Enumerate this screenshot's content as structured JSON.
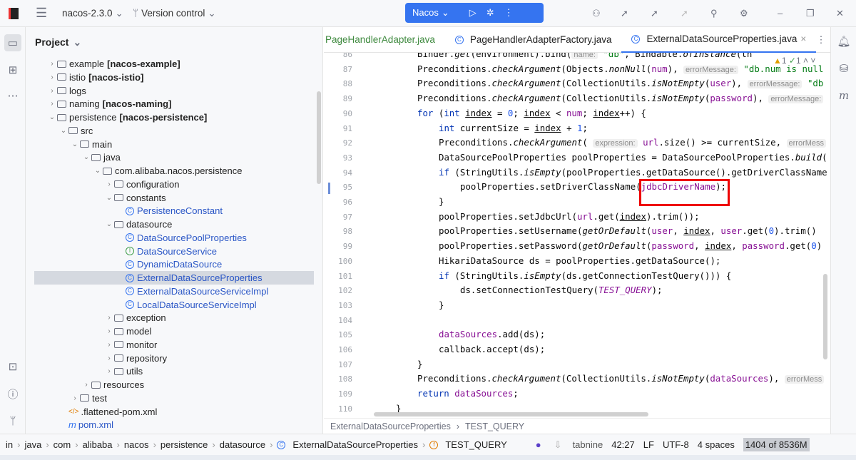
{
  "titlebar": {
    "project": "nacos-2.3.0",
    "vcs": "Version control",
    "run_config": "Nacos"
  },
  "project_panel": {
    "title": "Project",
    "tree": [
      {
        "label": "example",
        "module": "[nacos-example]",
        "level": 1,
        "type": "folder",
        "arrow": "›"
      },
      {
        "label": "istio",
        "module": "[nacos-istio]",
        "level": 1,
        "type": "folder",
        "arrow": "›"
      },
      {
        "label": "logs",
        "module": "",
        "level": 1,
        "type": "folder",
        "arrow": "›"
      },
      {
        "label": "naming",
        "module": "[nacos-naming]",
        "level": 1,
        "type": "folder",
        "arrow": "›"
      },
      {
        "label": "persistence",
        "module": "[nacos-persistence]",
        "level": 1,
        "type": "folder",
        "arrow": "⌄"
      },
      {
        "label": "src",
        "module": "",
        "level": 2,
        "type": "folder",
        "arrow": "⌄"
      },
      {
        "label": "main",
        "module": "",
        "level": 3,
        "type": "folder",
        "arrow": "⌄"
      },
      {
        "label": "java",
        "module": "",
        "level": 4,
        "type": "folder",
        "arrow": "⌄"
      },
      {
        "label": "com.alibaba.nacos.persistence",
        "module": "",
        "level": 5,
        "type": "folder",
        "arrow": "⌄"
      },
      {
        "label": "configuration",
        "module": "",
        "level": 6,
        "type": "folder",
        "arrow": "›"
      },
      {
        "label": "constants",
        "module": "",
        "level": 6,
        "type": "folder",
        "arrow": "⌄"
      },
      {
        "label": "PersistenceConstant",
        "module": "",
        "level": 7,
        "type": "class",
        "arrow": ""
      },
      {
        "label": "datasource",
        "module": "",
        "level": 6,
        "type": "folder",
        "arrow": "⌄"
      },
      {
        "label": "DataSourcePoolProperties",
        "module": "",
        "level": 7,
        "type": "class",
        "arrow": ""
      },
      {
        "label": "DataSourceService",
        "module": "",
        "level": 7,
        "type": "iface",
        "arrow": ""
      },
      {
        "label": "DynamicDataSource",
        "module": "",
        "level": 7,
        "type": "class",
        "arrow": ""
      },
      {
        "label": "ExternalDataSourceProperties",
        "module": "",
        "level": 7,
        "type": "class",
        "arrow": "",
        "selected": true
      },
      {
        "label": "ExternalDataSourceServiceImpl",
        "module": "",
        "level": 7,
        "type": "class",
        "arrow": ""
      },
      {
        "label": "LocalDataSourceServiceImpl",
        "module": "",
        "level": 7,
        "type": "class",
        "arrow": ""
      },
      {
        "label": "exception",
        "module": "",
        "level": 6,
        "type": "folder",
        "arrow": "›"
      },
      {
        "label": "model",
        "module": "",
        "level": 6,
        "type": "folder",
        "arrow": "›"
      },
      {
        "label": "monitor",
        "module": "",
        "level": 6,
        "type": "folder",
        "arrow": "›"
      },
      {
        "label": "repository",
        "module": "",
        "level": 6,
        "type": "folder",
        "arrow": "›"
      },
      {
        "label": "utils",
        "module": "",
        "level": 6,
        "type": "folder",
        "arrow": "›"
      },
      {
        "label": "resources",
        "module": "",
        "level": 4,
        "type": "folder",
        "arrow": "›"
      },
      {
        "label": "test",
        "module": "",
        "level": 3,
        "type": "folder",
        "arrow": "›"
      },
      {
        "label": ".flattened-pom.xml",
        "module": "",
        "level": 2,
        "type": "xml",
        "arrow": ""
      },
      {
        "label": "pom.xml",
        "module": "",
        "level": 2,
        "type": "maven",
        "arrow": ""
      }
    ]
  },
  "tabs": [
    {
      "label": "PageHandlerAdapter.java",
      "active": false
    },
    {
      "label": "PageHandlerAdapterFactory.java",
      "active": false
    },
    {
      "label": "ExternalDataSourceProperties.java",
      "active": true
    }
  ],
  "inspections": {
    "warnings": "1",
    "ok": "1"
  },
  "code": [
    {
      "n": "86",
      "i": 2,
      "s": [
        [
          "Binder.",
          ""
        ],
        [
          "get",
          "it"
        ],
        [
          "(environment).bind(",
          ""
        ],
        [
          "name:",
          "hint"
        ],
        [
          " ",
          ""
        ],
        [
          "\"db\"",
          "str"
        ],
        [
          ", Bindable.",
          ""
        ],
        [
          "ofInstance",
          "it"
        ],
        [
          "(th",
          ""
        ]
      ]
    },
    {
      "n": "87",
      "i": 2,
      "s": [
        [
          "Preconditions.",
          ""
        ],
        [
          "checkArgument",
          "it"
        ],
        [
          "(Objects.",
          ""
        ],
        [
          "nonNull",
          "it"
        ],
        [
          "(",
          ""
        ],
        [
          "num",
          "var"
        ],
        [
          "), ",
          ""
        ],
        [
          "errorMessage:",
          "hint"
        ],
        [
          " ",
          ""
        ],
        [
          "\"db.num is null",
          "str"
        ]
      ]
    },
    {
      "n": "88",
      "i": 2,
      "s": [
        [
          "Preconditions.",
          ""
        ],
        [
          "checkArgument",
          "it"
        ],
        [
          "(CollectionUtils.",
          ""
        ],
        [
          "isNotEmpty",
          "it"
        ],
        [
          "(",
          ""
        ],
        [
          "user",
          "var"
        ],
        [
          "), ",
          ""
        ],
        [
          "errorMessage:",
          "hint"
        ],
        [
          " ",
          ""
        ],
        [
          "\"db",
          "str"
        ]
      ]
    },
    {
      "n": "89",
      "i": 2,
      "s": [
        [
          "Preconditions.",
          ""
        ],
        [
          "checkArgument",
          "it"
        ],
        [
          "(CollectionUtils.",
          ""
        ],
        [
          "isNotEmpty",
          "it"
        ],
        [
          "(",
          ""
        ],
        [
          "password",
          "var"
        ],
        [
          "), ",
          ""
        ],
        [
          "errorMessage:",
          "hint"
        ]
      ]
    },
    {
      "n": "90",
      "i": 2,
      "s": [
        [
          "for",
          "kw"
        ],
        [
          " (",
          ""
        ],
        [
          "int",
          "kw"
        ],
        [
          " ",
          ""
        ],
        [
          "index",
          "ul"
        ],
        [
          " = ",
          ""
        ],
        [
          "0",
          "num"
        ],
        [
          "; ",
          ""
        ],
        [
          "index",
          "ul"
        ],
        [
          " < ",
          ""
        ],
        [
          "num",
          "var"
        ],
        [
          "; ",
          ""
        ],
        [
          "index",
          "ul"
        ],
        [
          "++) {",
          ""
        ]
      ]
    },
    {
      "n": "91",
      "i": 3,
      "s": [
        [
          "int",
          "kw"
        ],
        [
          " currentSize = ",
          ""
        ],
        [
          "index",
          "ul"
        ],
        [
          " + ",
          ""
        ],
        [
          "1",
          "num"
        ],
        [
          ";",
          ""
        ]
      ]
    },
    {
      "n": "92",
      "i": 3,
      "s": [
        [
          "Preconditions.",
          ""
        ],
        [
          "checkArgument",
          "it"
        ],
        [
          "( ",
          ""
        ],
        [
          "expression:",
          "hint"
        ],
        [
          " ",
          ""
        ],
        [
          "url",
          "var"
        ],
        [
          ".size() >= currentSize, ",
          ""
        ],
        [
          "errorMess",
          "hint"
        ]
      ]
    },
    {
      "n": "93",
      "i": 3,
      "s": [
        [
          "DataSourcePoolProperties poolProperties = DataSourcePoolProperties.",
          ""
        ],
        [
          "build",
          "it"
        ],
        [
          "(",
          ""
        ]
      ]
    },
    {
      "n": "94",
      "i": 3,
      "s": [
        [
          "if",
          "kw"
        ],
        [
          " (StringUtils.",
          ""
        ],
        [
          "isEmpty",
          "it"
        ],
        [
          "(poolProperties.getDataSource().getDriverClassName",
          ""
        ]
      ]
    },
    {
      "n": "95",
      "i": 4,
      "s": [
        [
          "poolProperties.setDriverClassName(",
          ""
        ],
        [
          "jdbcDriverName",
          "var"
        ],
        [
          ");",
          ""
        ]
      ]
    },
    {
      "n": "96",
      "i": 3,
      "s": [
        [
          "}",
          ""
        ]
      ]
    },
    {
      "n": "97",
      "i": 3,
      "s": [
        [
          "poolProperties.setJdbcUrl(",
          ""
        ],
        [
          "url",
          "var"
        ],
        [
          ".get(",
          ""
        ],
        [
          "index",
          "ul"
        ],
        [
          ").trim());",
          ""
        ]
      ]
    },
    {
      "n": "98",
      "i": 3,
      "s": [
        [
          "poolProperties.setUsername(",
          ""
        ],
        [
          "getOrDefault",
          "it"
        ],
        [
          "(",
          ""
        ],
        [
          "user",
          "var"
        ],
        [
          ", ",
          ""
        ],
        [
          "index",
          "ul"
        ],
        [
          ", ",
          ""
        ],
        [
          "user",
          "var"
        ],
        [
          ".get(",
          ""
        ],
        [
          "0",
          "num"
        ],
        [
          ").trim()",
          ""
        ]
      ]
    },
    {
      "n": "99",
      "i": 3,
      "s": [
        [
          "poolProperties.setPassword(",
          ""
        ],
        [
          "getOrDefault",
          "it"
        ],
        [
          "(",
          ""
        ],
        [
          "password",
          "var"
        ],
        [
          ", ",
          ""
        ],
        [
          "index",
          "ul"
        ],
        [
          ", ",
          ""
        ],
        [
          "password",
          "var"
        ],
        [
          ".get(",
          ""
        ],
        [
          "0",
          "num"
        ],
        [
          ")",
          ""
        ]
      ]
    },
    {
      "n": "100",
      "i": 3,
      "s": [
        [
          "HikariDataSource ds = poolProperties.getDataSource();",
          ""
        ]
      ]
    },
    {
      "n": "101",
      "i": 3,
      "s": [
        [
          "if",
          "kw"
        ],
        [
          " (StringUtils.",
          ""
        ],
        [
          "isEmpty",
          "it"
        ],
        [
          "(ds.getConnectionTestQuery())) {",
          ""
        ]
      ]
    },
    {
      "n": "102",
      "i": 4,
      "s": [
        [
          "ds.setConnectionTestQuery(",
          ""
        ],
        [
          "TEST_QUERY",
          "const"
        ],
        [
          ");",
          ""
        ]
      ]
    },
    {
      "n": "103",
      "i": 3,
      "s": [
        [
          "}",
          ""
        ]
      ]
    },
    {
      "n": "104",
      "i": 3,
      "s": []
    },
    {
      "n": "105",
      "i": 3,
      "s": [
        [
          "dataSources",
          "var"
        ],
        [
          ".add(ds);",
          ""
        ]
      ]
    },
    {
      "n": "106",
      "i": 3,
      "s": [
        [
          "callback.accept(ds);",
          ""
        ]
      ]
    },
    {
      "n": "107",
      "i": 2,
      "s": [
        [
          "}",
          ""
        ]
      ]
    },
    {
      "n": "108",
      "i": 2,
      "s": [
        [
          "Preconditions.",
          ""
        ],
        [
          "checkArgument",
          "it"
        ],
        [
          "(CollectionUtils.",
          ""
        ],
        [
          "isNotEmpty",
          "it"
        ],
        [
          "(",
          ""
        ],
        [
          "dataSources",
          "var"
        ],
        [
          "), ",
          ""
        ],
        [
          "errorMess",
          "hint"
        ]
      ]
    },
    {
      "n": "109",
      "i": 2,
      "s": [
        [
          "return",
          "kw"
        ],
        [
          " ",
          ""
        ],
        [
          "dataSources",
          "var"
        ],
        [
          ";",
          ""
        ]
      ]
    },
    {
      "n": "110",
      "i": 1,
      "s": [
        [
          "}",
          ""
        ]
      ]
    }
  ],
  "editor_breadcrumb": [
    "ExternalDataSourceProperties",
    "TEST_QUERY"
  ],
  "statusbar": {
    "path": [
      "in",
      "java",
      "com",
      "alibaba",
      "nacos",
      "persistence",
      "datasource",
      "ExternalDataSourceProperties",
      "TEST_QUERY"
    ],
    "plugin": "tabnine",
    "position": "42:27",
    "line_sep": "LF",
    "encoding": "UTF-8",
    "indent": "4 spaces",
    "memory": "1404 of 8536M"
  },
  "colors": {
    "accent": "#3574f0",
    "highlight_box": "#e00000"
  }
}
